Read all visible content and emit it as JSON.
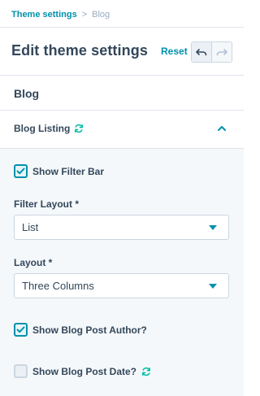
{
  "breadcrumb": {
    "parent": "Theme settings",
    "separator": ">",
    "current": "Blog"
  },
  "header": {
    "title": "Edit theme settings",
    "reset_label": "Reset",
    "undo_icon": "undo-icon",
    "redo_icon": "redo-icon"
  },
  "section": {
    "title": "Blog"
  },
  "group": {
    "title": "Blog Listing",
    "sync_icon": "sync-icon",
    "collapse_icon": "chevron-up-icon",
    "show_filter_bar": {
      "label": "Show Filter Bar",
      "checked": true
    },
    "filter_layout": {
      "label": "Filter Layout *",
      "value": "List"
    },
    "layout": {
      "label": "Layout *",
      "value": "Three Columns"
    },
    "show_author": {
      "label": "Show Blog Post Author?",
      "checked": true
    },
    "show_date": {
      "label": "Show Blog Post Date?",
      "checked": false,
      "has_sync_icon": true
    }
  },
  "colors": {
    "accent": "#0091ae",
    "text": "#33475b",
    "panel_bg": "#f5f8fa",
    "border": "#cbd6e2"
  }
}
